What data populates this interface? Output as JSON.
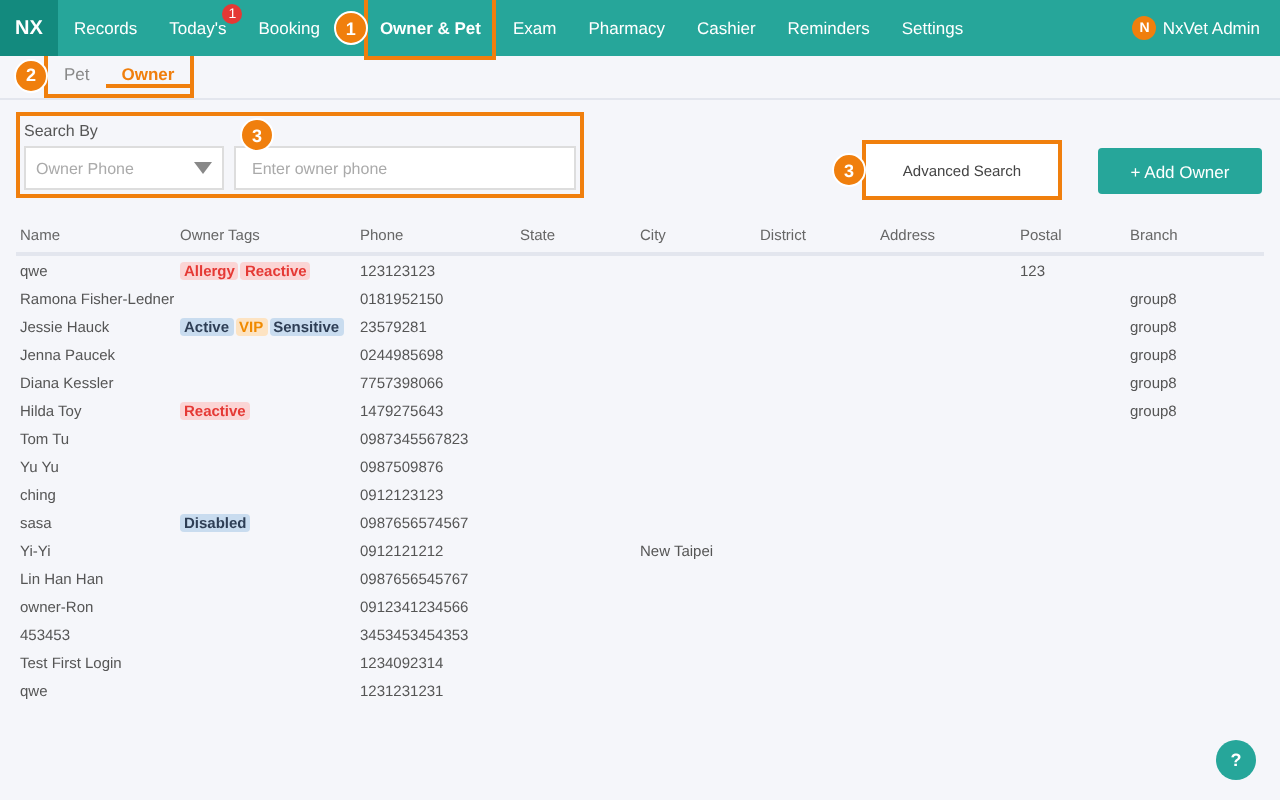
{
  "nav": {
    "logo": "NX",
    "items": [
      {
        "label": "Records",
        "selected": false
      },
      {
        "label": "Today's",
        "selected": false,
        "badge": "1"
      },
      {
        "label": "Booking",
        "selected": false
      },
      {
        "label": "Owner & Pet",
        "selected": true,
        "callout": "1"
      },
      {
        "label": "Exam",
        "selected": false
      },
      {
        "label": "Pharmacy",
        "selected": false
      },
      {
        "label": "Cashier",
        "selected": false
      },
      {
        "label": "Reminders",
        "selected": false
      },
      {
        "label": "Settings",
        "selected": false
      }
    ],
    "user": {
      "initial": "N",
      "name": "NxVet Admin"
    }
  },
  "subtabs": {
    "callout": "2",
    "items": [
      {
        "label": "Pet",
        "selected": false
      },
      {
        "label": "Owner",
        "selected": true
      }
    ]
  },
  "search": {
    "callout": "3",
    "label": "Search By",
    "by": "Owner Phone",
    "placeholder": "Enter owner phone"
  },
  "advanced_search": {
    "label": "Advanced Search",
    "callout": "3"
  },
  "add_button": "+ Add Owner",
  "table": {
    "columns": [
      "Name",
      "Owner Tags",
      "Phone",
      "State",
      "City",
      "District",
      "Address",
      "Postal",
      "Branch"
    ],
    "rows": [
      {
        "name": "qwe",
        "tags": [
          {
            "label": "Allergy",
            "kind": "danger"
          },
          {
            "label": "Reactive",
            "kind": "danger"
          }
        ],
        "phone": "123123123",
        "city": "",
        "postal": "123",
        "branch": ""
      },
      {
        "name": "Ramona Fisher-Ledner",
        "tags": [],
        "phone": "0181952150",
        "city": "",
        "postal": "",
        "branch": "group8"
      },
      {
        "name": "Jessie Hauck",
        "tags": [
          {
            "label": "Active",
            "kind": "info"
          },
          {
            "label": "VIP",
            "kind": "warning"
          },
          {
            "label": "Sensitive",
            "kind": "info"
          }
        ],
        "phone": "23579281",
        "city": "",
        "postal": "",
        "branch": "group8"
      },
      {
        "name": "Jenna Paucek",
        "tags": [],
        "phone": "0244985698",
        "city": "",
        "postal": "",
        "branch": "group8"
      },
      {
        "name": "Diana Kessler",
        "tags": [],
        "phone": "7757398066",
        "city": "",
        "postal": "",
        "branch": "group8"
      },
      {
        "name": "Hilda Toy",
        "tags": [
          {
            "label": "Reactive",
            "kind": "danger"
          }
        ],
        "phone": "1479275643",
        "city": "",
        "postal": "",
        "branch": "group8"
      },
      {
        "name": "Tom Tu",
        "tags": [],
        "phone": "0987345567823",
        "city": "",
        "postal": "",
        "branch": ""
      },
      {
        "name": "Yu Yu",
        "tags": [],
        "phone": "0987509876",
        "city": "",
        "postal": "",
        "branch": ""
      },
      {
        "name": "ching",
        "tags": [],
        "phone": "0912123123",
        "city": "",
        "postal": "",
        "branch": ""
      },
      {
        "name": "sasa",
        "tags": [
          {
            "label": "Disabled",
            "kind": "info"
          }
        ],
        "phone": "0987656574567",
        "city": "",
        "postal": "",
        "branch": ""
      },
      {
        "name": "Yi-Yi",
        "tags": [],
        "phone": "0912121212",
        "city": "New Taipei",
        "postal": "",
        "branch": ""
      },
      {
        "name": "Lin Han Han",
        "tags": [],
        "phone": "0987656545767",
        "city": "",
        "postal": "",
        "branch": ""
      },
      {
        "name": "owner-Ron",
        "tags": [],
        "phone": "0912341234566",
        "city": "",
        "postal": "",
        "branch": ""
      },
      {
        "name": "453453",
        "tags": [],
        "phone": "3453453454353",
        "city": "",
        "postal": "",
        "branch": ""
      },
      {
        "name": "Test First Login",
        "tags": [],
        "phone": "1234092314",
        "city": "",
        "postal": "",
        "branch": ""
      },
      {
        "name": "qwe",
        "tags": [],
        "phone": "1231231231",
        "city": "",
        "postal": "",
        "branch": ""
      }
    ]
  },
  "help_button": "?"
}
